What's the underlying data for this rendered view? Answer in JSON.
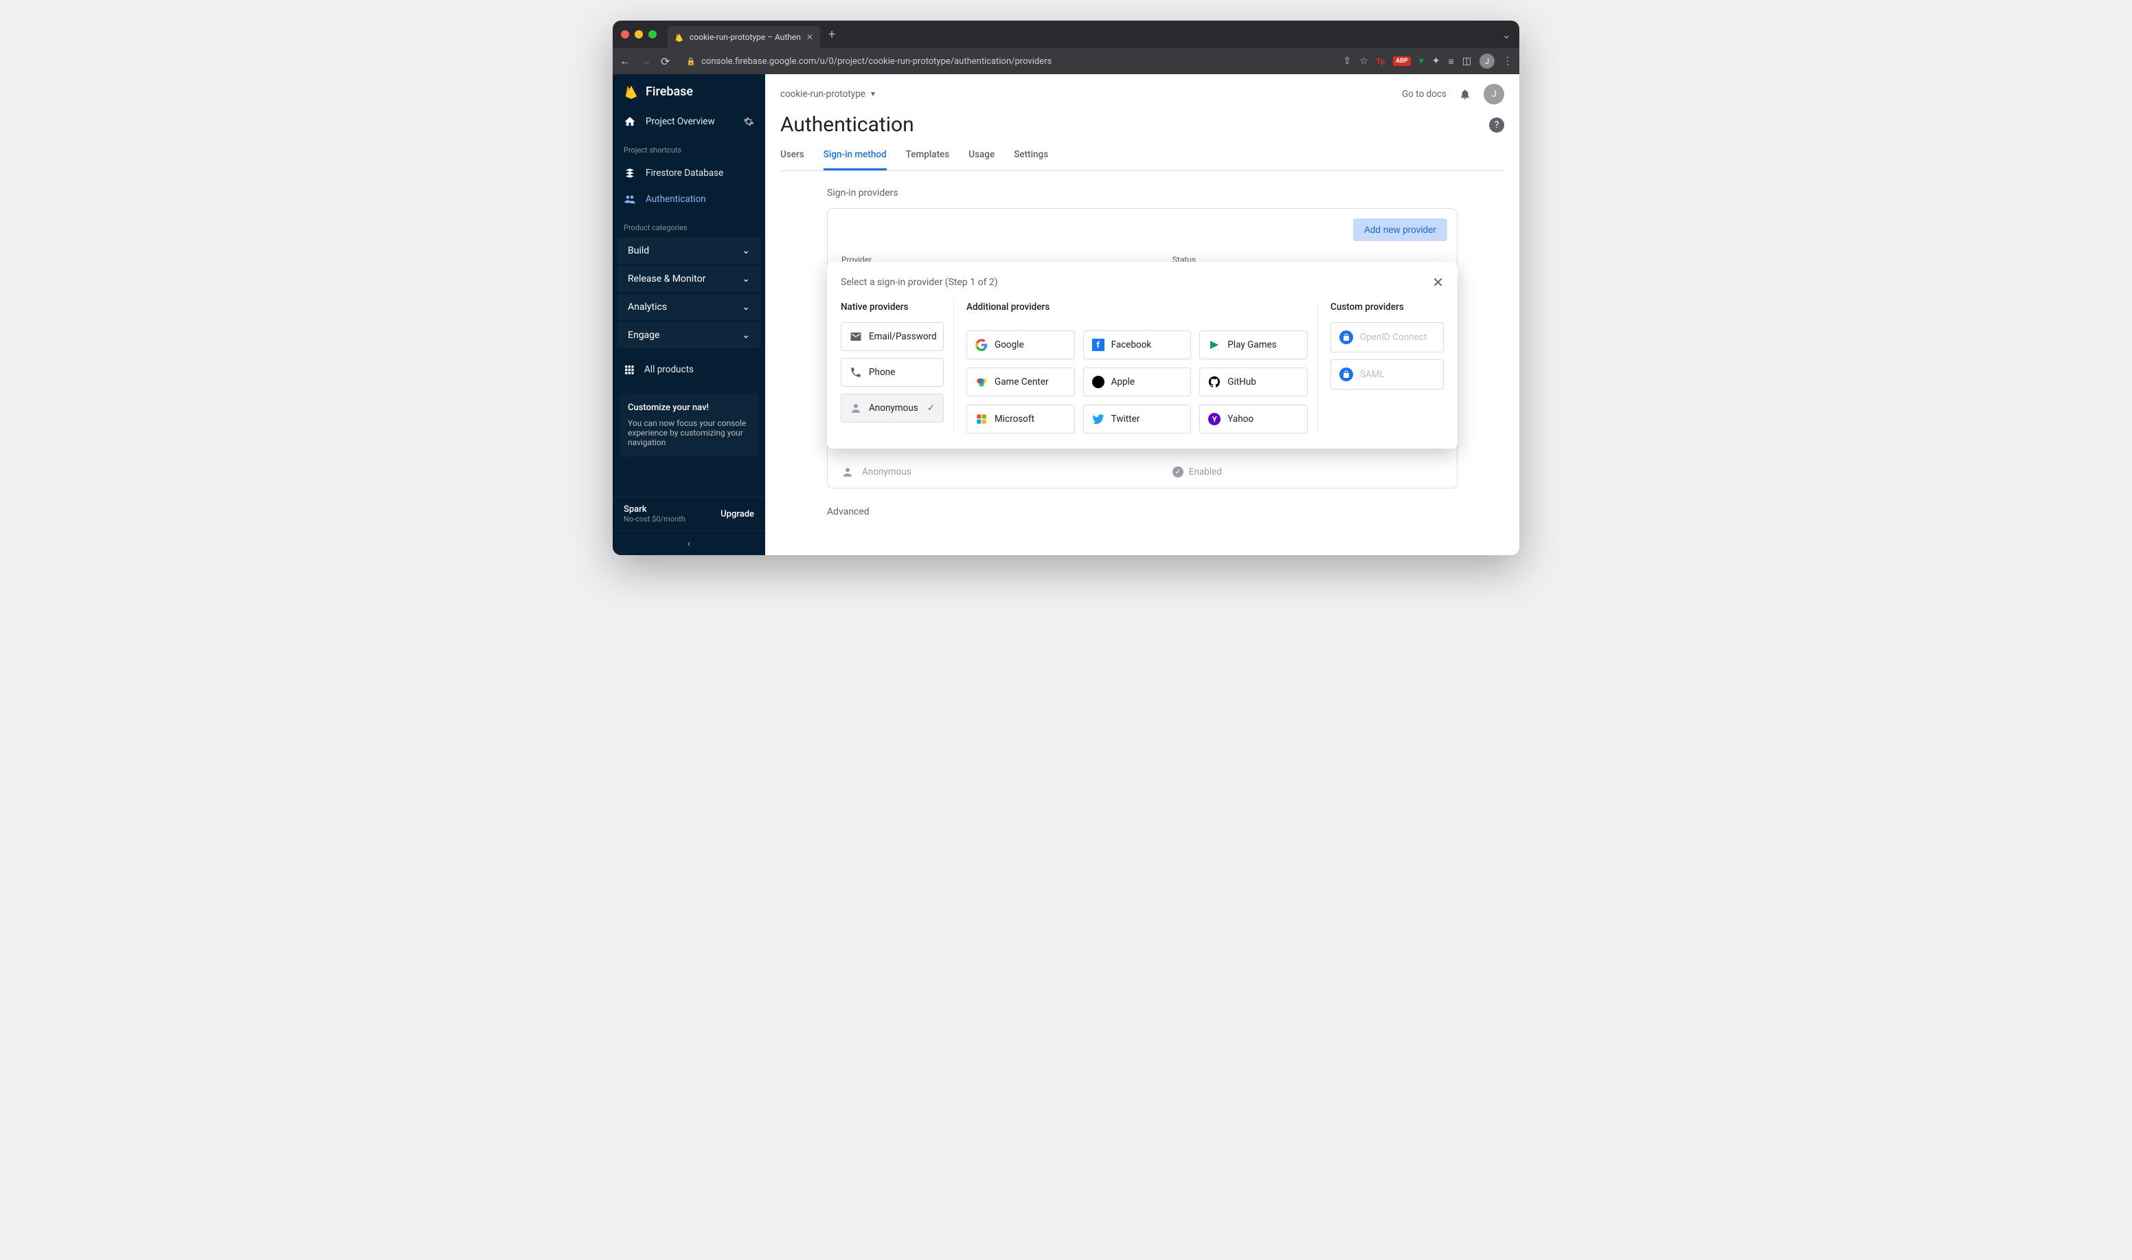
{
  "browser": {
    "tab_title": "cookie-run-prototype – Authen",
    "url": "console.firebase.google.com/u/0/project/cookie-run-prototype/authentication/providers",
    "avatar_letter": "J"
  },
  "sidebar": {
    "product": "Firebase",
    "overview": "Project Overview",
    "shortcuts_label": "Project shortcuts",
    "shortcuts": [
      {
        "label": "Firestore Database",
        "icon": "firestore"
      },
      {
        "label": "Authentication",
        "icon": "auth",
        "active": true
      }
    ],
    "categories_label": "Product categories",
    "categories": [
      {
        "label": "Build"
      },
      {
        "label": "Release & Monitor"
      },
      {
        "label": "Analytics"
      },
      {
        "label": "Engage"
      }
    ],
    "all_products": "All products",
    "promo": {
      "title": "Customize your nav!",
      "body": "You can now focus your console experience by customizing your navigation"
    },
    "plan": {
      "name": "Spark",
      "sub": "No-cost $0/month",
      "upgrade": "Upgrade"
    }
  },
  "header": {
    "project": "cookie-run-prototype",
    "docs_link": "Go to docs",
    "avatar_letter": "J",
    "page_title": "Authentication"
  },
  "tabs": [
    {
      "label": "Users"
    },
    {
      "label": "Sign-in method",
      "active": true
    },
    {
      "label": "Templates"
    },
    {
      "label": "Usage"
    },
    {
      "label": "Settings"
    }
  ],
  "providers_section": {
    "label": "Sign-in providers",
    "add_button": "Add new provider",
    "col_provider": "Provider",
    "col_status": "Status",
    "existing": {
      "name": "Anonymous",
      "status": "Enabled"
    },
    "advanced": "Advanced"
  },
  "modal": {
    "title": "Select a sign-in provider (Step 1 of 2)",
    "columns": {
      "native": "Native providers",
      "additional": "Additional providers",
      "custom": "Custom providers"
    },
    "native": [
      {
        "label": "Email/Password",
        "icon": "email"
      },
      {
        "label": "Phone",
        "icon": "phone"
      },
      {
        "label": "Anonymous",
        "icon": "anon",
        "selected": true
      }
    ],
    "additional": [
      {
        "label": "Google",
        "icon": "google"
      },
      {
        "label": "Facebook",
        "icon": "facebook"
      },
      {
        "label": "Play Games",
        "icon": "playgames"
      },
      {
        "label": "Game Center",
        "icon": "gamecenter"
      },
      {
        "label": "Apple",
        "icon": "apple"
      },
      {
        "label": "GitHub",
        "icon": "github"
      },
      {
        "label": "Microsoft",
        "icon": "microsoft"
      },
      {
        "label": "Twitter",
        "icon": "twitter"
      },
      {
        "label": "Yahoo",
        "icon": "yahoo"
      }
    ],
    "custom": [
      {
        "label": "OpenID Connect",
        "icon": "lock",
        "disabled": true
      },
      {
        "label": "SAML",
        "icon": "lock",
        "disabled": true
      }
    ]
  }
}
